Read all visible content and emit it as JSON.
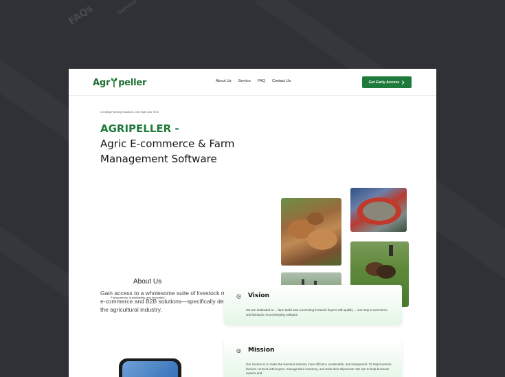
{
  "background": {
    "words": [
      "FAQs",
      "Service"
    ]
  },
  "nav": {
    "logo": {
      "prefix": "Agr",
      "suffix": "peller"
    },
    "links": [
      "About Us",
      "Service",
      "FAQ",
      "Contact Us"
    ],
    "cta": "Get Early Access"
  },
  "hero": {
    "eyebrow": "Creating Farming Solutions, One Byte at a Time",
    "title_green": "AGRIPELLER -",
    "title_line2": "Agric E-commerce & Farm",
    "title_line3": "Management Software"
  },
  "about": {
    "heading": "About Us",
    "description": "Gain access to a wholesome suite of livestock management, e-commerce and B2B solutions—specifically designed for the agricultural industry.",
    "tagline": "\"Transparency, Sustainability, and Innovation\""
  },
  "vision": {
    "title": "Vision",
    "text": "We are dedicated to ... farm tasks and connecting livestock buyers with quality ... one-stop e-commerce and livestock record keeping software"
  },
  "mission": {
    "title": "Mission",
    "text": "Our mission is to make the livestock industry more efficient, sustainable, and transparent. To help livestock farmers connect with buyers, manage their inventory, and track their shipments. We aim to help business owners and"
  },
  "colors": {
    "brand_green": "#1e7a3a",
    "card_tint": "#e3f7e6",
    "backdrop": "#2f3136"
  },
  "icons": {
    "cta": "chevron-right-icon",
    "card": "target-icon"
  }
}
